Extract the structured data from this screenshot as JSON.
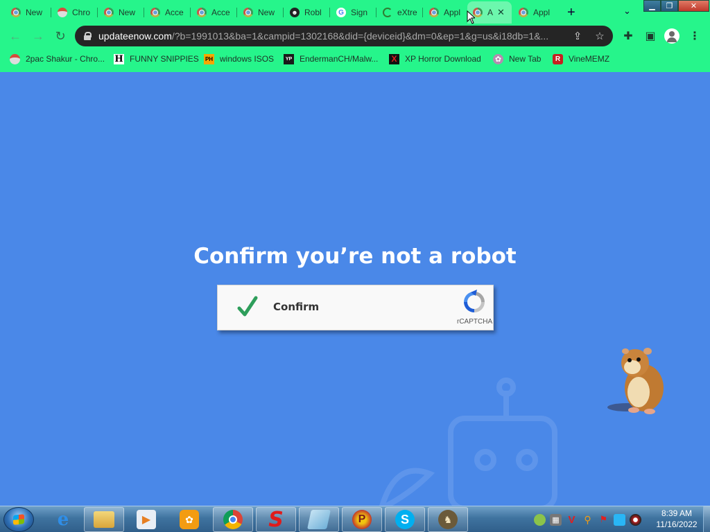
{
  "browser": {
    "tabs": [
      {
        "title": "New",
        "icon": "chrome-icon"
      },
      {
        "title": "Chro",
        "icon": "chrome-red-icon"
      },
      {
        "title": "New",
        "icon": "chrome-icon"
      },
      {
        "title": "Acce",
        "icon": "chrome-icon"
      },
      {
        "title": "Acce",
        "icon": "chrome-icon"
      },
      {
        "title": "New",
        "icon": "chrome-icon"
      },
      {
        "title": "Robl",
        "icon": "robot-icon"
      },
      {
        "title": "Sign",
        "icon": "google-icon"
      },
      {
        "title": "eXtre",
        "icon": "loading-spinner-icon"
      },
      {
        "title": "Appl",
        "icon": "chrome-icon"
      },
      {
        "title": "A",
        "icon": "chrome-icon",
        "active": true
      },
      {
        "title": "Appl",
        "icon": "chrome-icon"
      }
    ],
    "new_tab_label": "+",
    "tab_search_label": "⌄",
    "window_controls": {
      "minimize": "▁",
      "maximize": "❐",
      "close": "✕"
    },
    "address_bar": {
      "host": "updateenow.com",
      "path": "/?b=1991013&ba=1&campid=1302168&did={deviceid}&dm=0&ep=1&g=us&i18db=1&..."
    },
    "bookmarks": [
      {
        "label": "2pac Shakur - Chro...",
        "icon": "chrome-red-icon"
      },
      {
        "label": "FUNNY SNIPPIES",
        "icon": "h-logo-icon",
        "glyph": "H"
      },
      {
        "label": "windows ISOS",
        "icon": "ph-logo-icon",
        "glyph": "PH"
      },
      {
        "label": "EndermanCH/Malw...",
        "icon": "yp-logo-icon",
        "glyph": "YP"
      },
      {
        "label": "XP Horror Download",
        "icon": "x-logo-icon",
        "glyph": "X"
      },
      {
        "label": "New Tab",
        "icon": "bug-icon",
        "glyph": "✿"
      },
      {
        "label": "VineMEMZ",
        "icon": "r-logo-icon",
        "glyph": "R"
      }
    ]
  },
  "page": {
    "heading": "Confirm you’re not a robot",
    "captcha": {
      "label": "Confirm",
      "brand": "rCAPTCHA"
    },
    "colors": {
      "background": "#4a88e8",
      "check": "#2e9e5b",
      "chrome_frame": "#26f58b"
    }
  },
  "taskbar": {
    "start_label": "Start",
    "apps": [
      {
        "name": "internet-explorer",
        "pinned": false
      },
      {
        "name": "file-explorer",
        "pinned": true
      },
      {
        "name": "media-player",
        "pinned": false
      },
      {
        "name": "uc-browser",
        "pinned": false
      },
      {
        "name": "google-chrome",
        "pinned": true
      },
      {
        "name": "red-s-app",
        "pinned": true
      },
      {
        "name": "notepad-app",
        "pinned": true
      },
      {
        "name": "p-browser",
        "pinned": true
      },
      {
        "name": "skype",
        "pinned": true
      },
      {
        "name": "bonzi-app",
        "pinned": true
      }
    ],
    "clock": {
      "time": "8:39 AM",
      "date": "11/16/2022"
    }
  }
}
